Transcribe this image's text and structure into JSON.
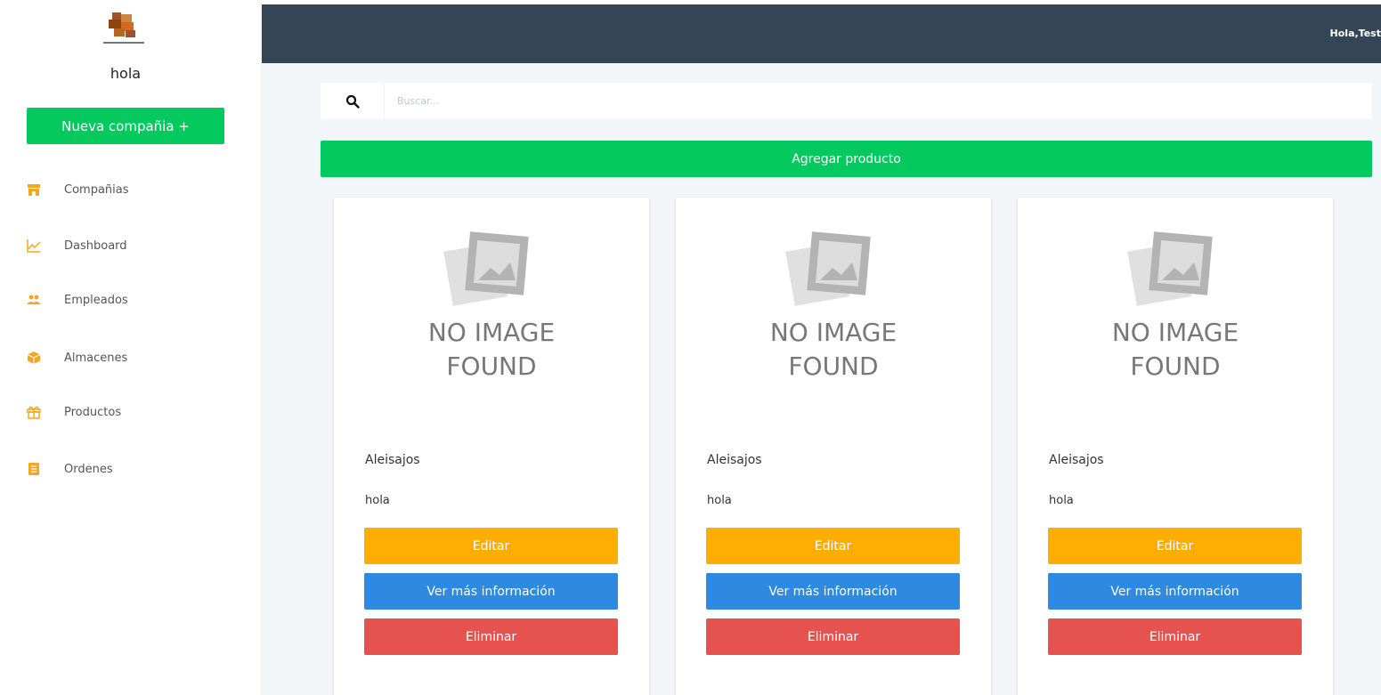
{
  "sidebar": {
    "logo_icon": "inventory-boxes-logo",
    "company_name": "hola",
    "new_company_label": "Nueva compañia +",
    "items": [
      {
        "label": "Compañias",
        "icon": "store-icon"
      },
      {
        "label": "Dashboard",
        "icon": "chart-line-icon"
      },
      {
        "label": "Empleados",
        "icon": "users-icon"
      },
      {
        "label": "Almacenes",
        "icon": "box-icon"
      },
      {
        "label": "Productos",
        "icon": "gift-icon"
      },
      {
        "label": "Ordenes",
        "icon": "list-icon"
      }
    ]
  },
  "topbar": {
    "greeting": "Hola,Test"
  },
  "search": {
    "placeholder": "Buscar...",
    "icon": "search-icon"
  },
  "add_product_label": "Agregar producto",
  "products": [
    {
      "image_line1": "NO IMAGE",
      "image_line2": "FOUND",
      "name": "Aleisajos",
      "description": "hola",
      "edit_label": "Editar",
      "info_label": "Ver más información",
      "delete_label": "Eliminar"
    },
    {
      "image_line1": "NO IMAGE",
      "image_line2": "FOUND",
      "name": "Aleisajos",
      "description": "hola",
      "edit_label": "Editar",
      "info_label": "Ver más información",
      "delete_label": "Eliminar"
    },
    {
      "image_line1": "NO IMAGE",
      "image_line2": "FOUND",
      "name": "Aleisajos",
      "description": "hola",
      "edit_label": "Editar",
      "info_label": "Ver más información",
      "delete_label": "Eliminar"
    }
  ],
  "colors": {
    "topbar": "#344655",
    "green": "#04c95f",
    "orange_icon": "#f5a623",
    "edit": "#ffae00",
    "info": "#2e8ae0",
    "delete": "#e55250",
    "main_bg": "#f2f6f9"
  }
}
